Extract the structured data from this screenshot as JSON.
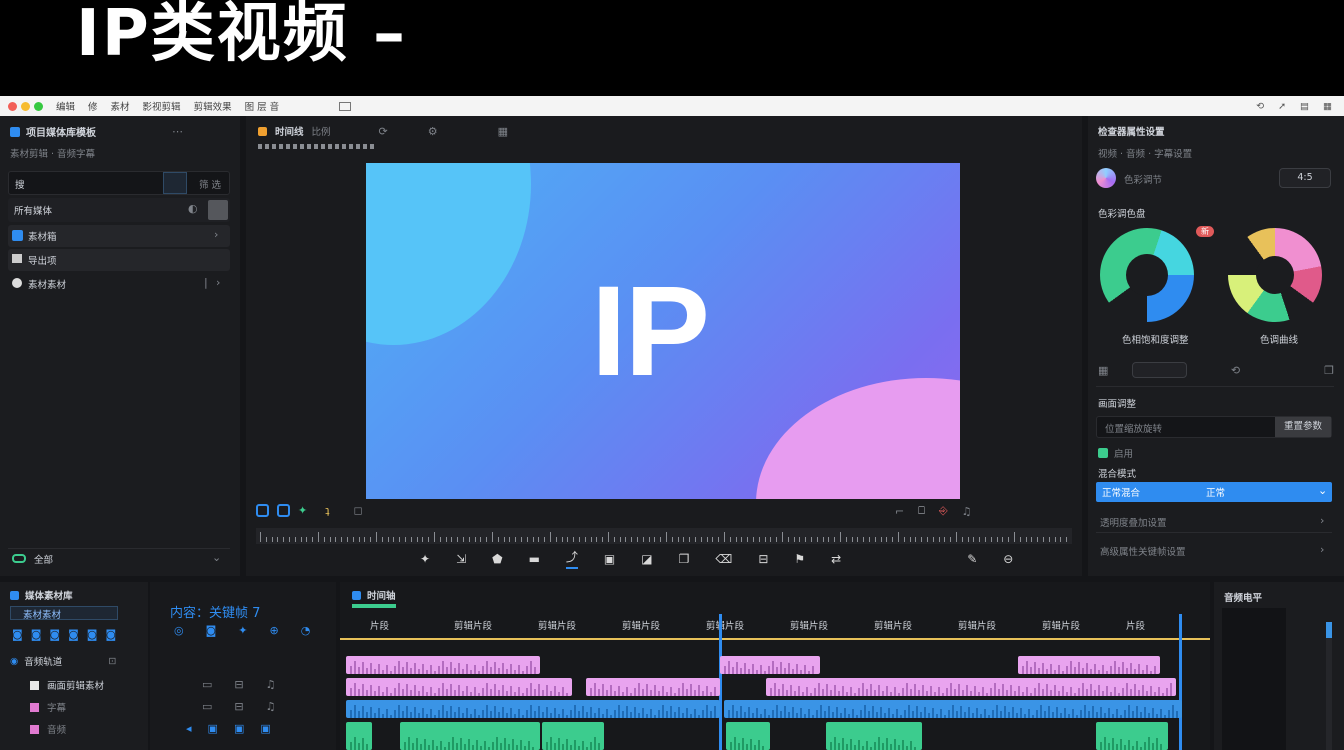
{
  "banner": {
    "title": "IP类视频 –"
  },
  "menubar": {
    "items": [
      "编辑",
      "修",
      "素材",
      "影视剪辑",
      "剪辑效果",
      "图 层 音"
    ],
    "right_icons": [
      "sync-icon",
      "send-icon",
      "doc-icon",
      "grid-icon"
    ]
  },
  "left_panel": {
    "title": "项目媒体库模板",
    "subtitle": "素材剪辑 · 音频字幕",
    "search_placeholder": "搜",
    "search_hint": "筛 选",
    "folder_label": "所有媒体",
    "items": [
      "素材箱",
      "导出项",
      "素材素材"
    ],
    "bottom_label": "全部"
  },
  "viewer": {
    "title": "时间线",
    "tab2": "比例",
    "preview_text": "IP"
  },
  "inspector": {
    "title": "检查器属性设置",
    "subtitle": "视频 · 音频 · 字幕设置",
    "profile_label": "色彩调节",
    "profile_value": "4:5",
    "section_color": "色彩调色盘",
    "wheel_left_label": "色相饱和度调整",
    "wheel_right_label": "色调曲线",
    "badge": "新",
    "section_transform": "画面调整",
    "field_placeholder": "位置缩放旋转",
    "field_button": "重置参数",
    "checkbox_label": "启用",
    "section_blend": "混合模式",
    "blend_selected": "正常混合",
    "blend_value": "正常",
    "option1": "透明度叠加设置",
    "option2": "高级属性关键帧设置"
  },
  "media_bin": {
    "title": "媒体素材库",
    "tab": "素材素材",
    "section": "音频轨道",
    "rows": [
      "画面剪辑素材",
      "字幕",
      "音频"
    ]
  },
  "tracks": {
    "heading": "内容：关键帧 7"
  },
  "timeline": {
    "title": "时间轴",
    "ruler": [
      "片段",
      "剪辑片段",
      "剪辑片段",
      "剪辑片段",
      "剪辑片段",
      "剪辑片段",
      "剪辑片段",
      "剪辑片段",
      "剪辑片段",
      "片段"
    ]
  },
  "meter": {
    "title": "音频电平"
  },
  "colors": {
    "accent": "#2f8cf0",
    "pink_clip": "#e9a4ef",
    "blue_clip": "#3a94e6",
    "green_clip": "#3ccc8e",
    "playhead": "#e8c15a"
  }
}
